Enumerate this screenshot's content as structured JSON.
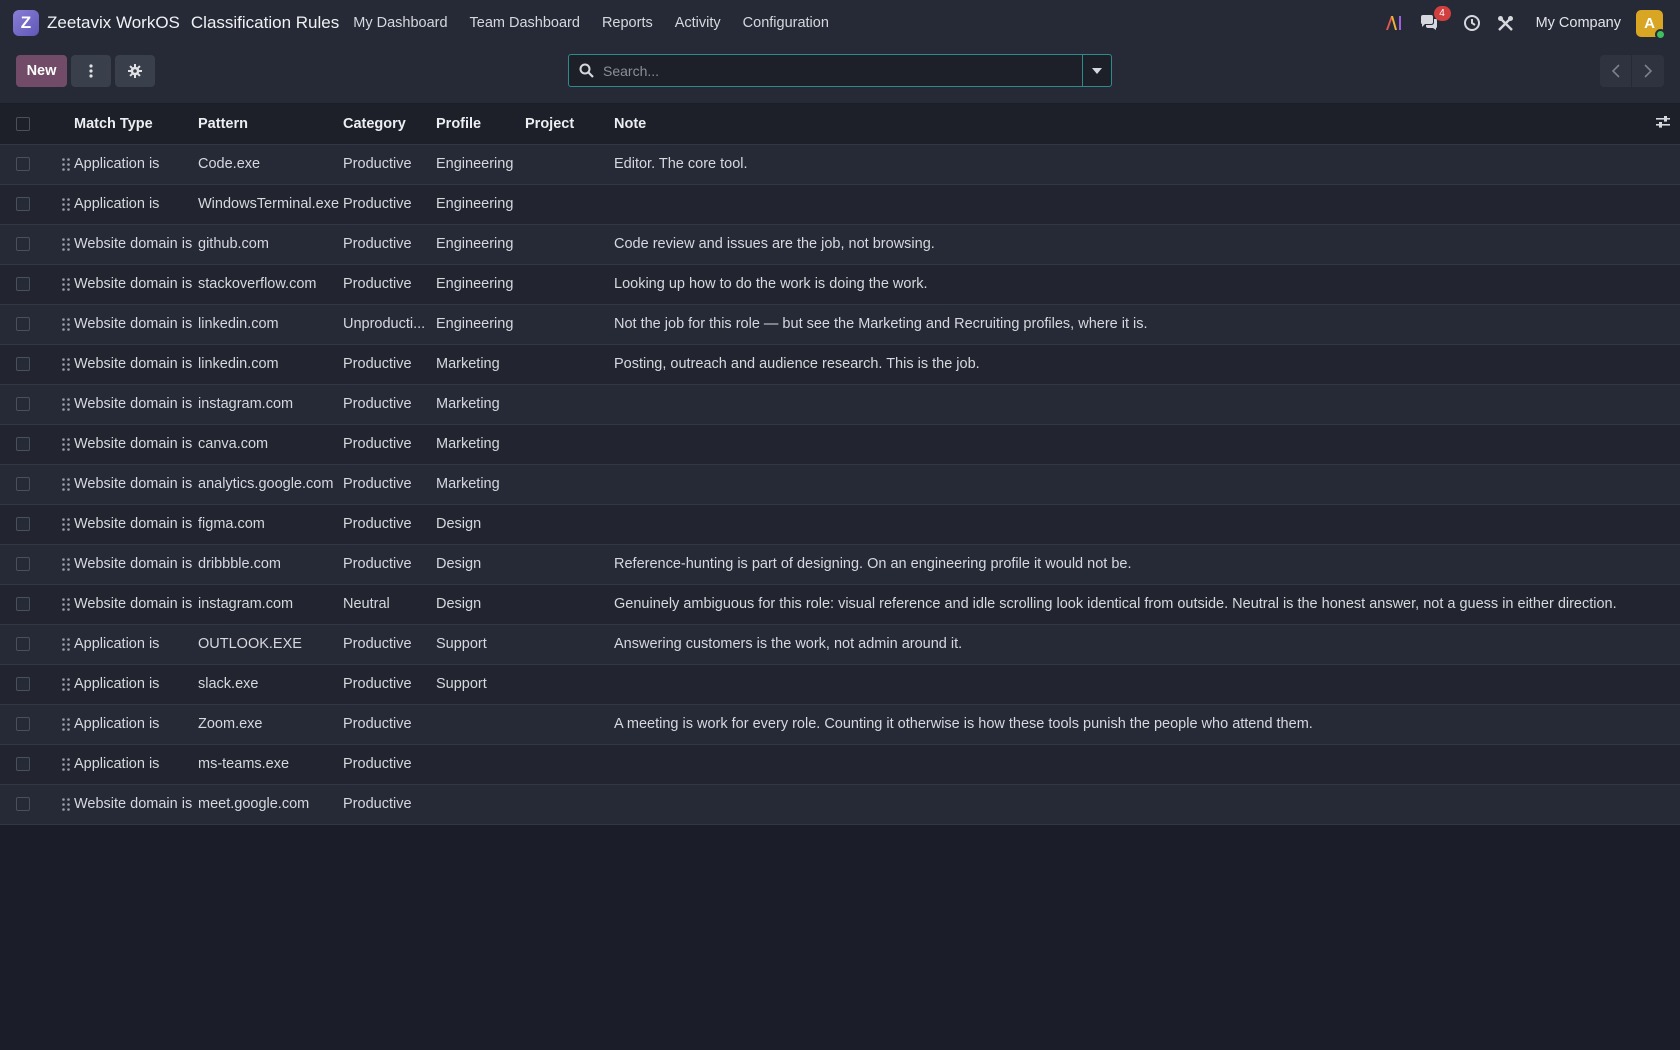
{
  "navbar": {
    "logo_letter": "Z",
    "brand": "Zeetavix WorkOS",
    "app_title": "Classification Rules",
    "menu": [
      "My Dashboard",
      "Team Dashboard",
      "Reports",
      "Activity",
      "Configuration"
    ],
    "messages_badge": "4",
    "company": "My Company",
    "avatar_letter": "A",
    "ai_label": "AI"
  },
  "control": {
    "new_label": "New",
    "search_placeholder": "Search..."
  },
  "table": {
    "columns": [
      "Match Type",
      "Pattern",
      "Category",
      "Profile",
      "Project",
      "Note"
    ],
    "rows": [
      {
        "match_type": "Application is",
        "pattern": "Code.exe",
        "category": "Productive",
        "profile": "Engineering",
        "project": "",
        "note": "Editor. The core tool."
      },
      {
        "match_type": "Application is",
        "pattern": "WindowsTerminal.exe",
        "category": "Productive",
        "profile": "Engineering",
        "project": "",
        "note": ""
      },
      {
        "match_type": "Website domain is",
        "pattern": "github.com",
        "category": "Productive",
        "profile": "Engineering",
        "project": "",
        "note": "Code review and issues are the job, not browsing."
      },
      {
        "match_type": "Website domain is",
        "pattern": "stackoverflow.com",
        "category": "Productive",
        "profile": "Engineering",
        "project": "",
        "note": "Looking up how to do the work is doing the work."
      },
      {
        "match_type": "Website domain is",
        "pattern": "linkedin.com",
        "category": "Unproducti...",
        "profile": "Engineering",
        "project": "",
        "note": "Not the job for this role — but see the Marketing and Recruiting profiles, where it is."
      },
      {
        "match_type": "Website domain is",
        "pattern": "linkedin.com",
        "category": "Productive",
        "profile": "Marketing",
        "project": "",
        "note": "Posting, outreach and audience research. This is the job."
      },
      {
        "match_type": "Website domain is",
        "pattern": "instagram.com",
        "category": "Productive",
        "profile": "Marketing",
        "project": "",
        "note": ""
      },
      {
        "match_type": "Website domain is",
        "pattern": "canva.com",
        "category": "Productive",
        "profile": "Marketing",
        "project": "",
        "note": ""
      },
      {
        "match_type": "Website domain is",
        "pattern": "analytics.google.com",
        "category": "Productive",
        "profile": "Marketing",
        "project": "",
        "note": ""
      },
      {
        "match_type": "Website domain is",
        "pattern": "figma.com",
        "category": "Productive",
        "profile": "Design",
        "project": "",
        "note": ""
      },
      {
        "match_type": "Website domain is",
        "pattern": "dribbble.com",
        "category": "Productive",
        "profile": "Design",
        "project": "",
        "note": "Reference-hunting is part of designing. On an engineering profile it would not be."
      },
      {
        "match_type": "Website domain is",
        "pattern": "instagram.com",
        "category": "Neutral",
        "profile": "Design",
        "project": "",
        "note": "Genuinely ambiguous for this role: visual reference and idle scrolling look identical from outside. Neutral is the honest answer, not a guess in either direction."
      },
      {
        "match_type": "Application is",
        "pattern": "OUTLOOK.EXE",
        "category": "Productive",
        "profile": "Support",
        "project": "",
        "note": "Answering customers is the work, not admin around it."
      },
      {
        "match_type": "Application is",
        "pattern": "slack.exe",
        "category": "Productive",
        "profile": "Support",
        "project": "",
        "note": ""
      },
      {
        "match_type": "Application is",
        "pattern": "Zoom.exe",
        "category": "Productive",
        "profile": "",
        "project": "",
        "note": "A meeting is work for every role. Counting it otherwise is how these tools punish the people who attend them."
      },
      {
        "match_type": "Application is",
        "pattern": "ms-teams.exe",
        "category": "Productive",
        "profile": "",
        "project": "",
        "note": ""
      },
      {
        "match_type": "Website domain is",
        "pattern": "meet.google.com",
        "category": "Productive",
        "profile": "",
        "project": "",
        "note": ""
      }
    ]
  }
}
